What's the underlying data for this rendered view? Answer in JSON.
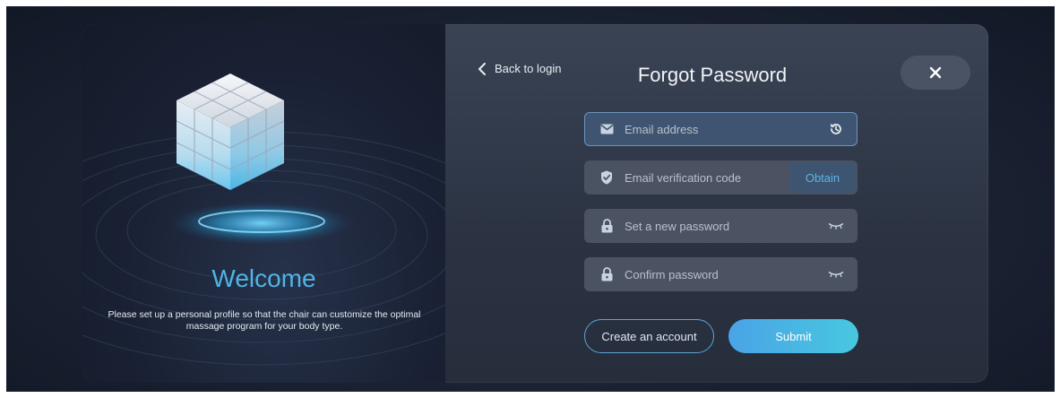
{
  "left_panel": {
    "welcome_title": "Welcome",
    "welcome_desc": "Please set up a personal profile so that the chair can customize the optimal massage program for your body type."
  },
  "header": {
    "back_label": "Back to login",
    "title": "Forgot Password",
    "close_icon": "close-icon"
  },
  "form": {
    "email": {
      "placeholder": "Email address",
      "icon": "mail-icon",
      "trailing_icon": "history-icon"
    },
    "code": {
      "placeholder": "Email verification code",
      "icon": "shield-icon",
      "action_label": "Obtain"
    },
    "new_password": {
      "placeholder": "Set a new password",
      "icon": "lock-icon",
      "trailing_icon": "eye-closed-icon"
    },
    "confirm_password": {
      "placeholder": "Confirm password",
      "icon": "lock-icon",
      "trailing_icon": "eye-closed-icon"
    }
  },
  "buttons": {
    "create_account": "Create an account",
    "submit": "Submit"
  },
  "colors": {
    "accent": "#4fb4e6",
    "submit_gradient_start": "#4aa3e6",
    "submit_gradient_end": "#48c8e0",
    "panel_bg": "#2b3343"
  }
}
